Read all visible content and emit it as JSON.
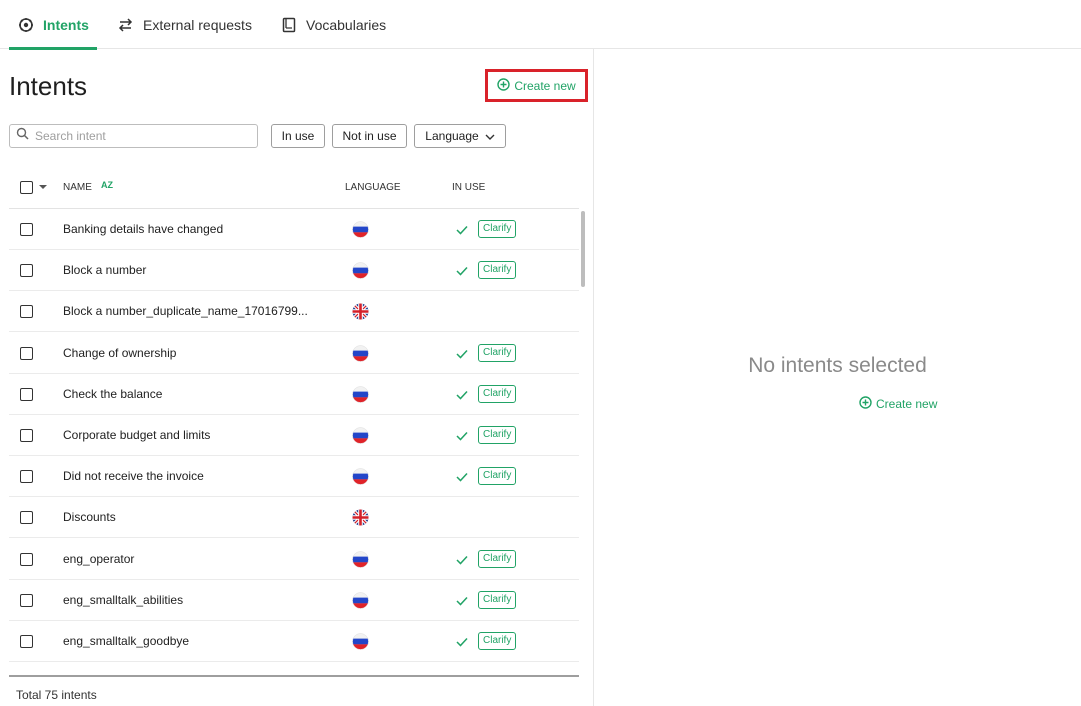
{
  "tabs": [
    {
      "label": "Intents",
      "icon": "brain-gear-icon",
      "active": true
    },
    {
      "label": "External requests",
      "icon": "swap-arrows-icon",
      "active": false
    },
    {
      "label": "Vocabularies",
      "icon": "book-icon",
      "active": false
    }
  ],
  "left_panel": {
    "title": "Intents",
    "create_label": "Create new",
    "search_placeholder": "Search intent",
    "filters": {
      "in_use": "In use",
      "not_in_use": "Not in use",
      "language": "Language"
    },
    "columns": {
      "name": "NAME",
      "sort_indicator": "AZ",
      "language": "LANGUAGE",
      "in_use": "IN USE"
    },
    "rows": [
      {
        "name": "Banking details have changed",
        "lang": "ru",
        "in_use": true,
        "badge": "Clarify"
      },
      {
        "name": "Block a number",
        "lang": "ru",
        "in_use": true,
        "badge": "Clarify"
      },
      {
        "name": "Block a number_duplicate_name_17016799...",
        "lang": "gb",
        "in_use": false,
        "badge": ""
      },
      {
        "name": "Change of ownership",
        "lang": "ru",
        "in_use": true,
        "badge": "Clarify"
      },
      {
        "name": "Check the balance",
        "lang": "ru",
        "in_use": true,
        "badge": "Clarify"
      },
      {
        "name": "Corporate budget and limits",
        "lang": "ru",
        "in_use": true,
        "badge": "Clarify"
      },
      {
        "name": "Did not receive the invoice",
        "lang": "ru",
        "in_use": true,
        "badge": "Clarify"
      },
      {
        "name": "Discounts",
        "lang": "gb",
        "in_use": false,
        "badge": ""
      },
      {
        "name": "eng_operator",
        "lang": "ru",
        "in_use": true,
        "badge": "Clarify"
      },
      {
        "name": "eng_smalltalk_abilities",
        "lang": "ru",
        "in_use": true,
        "badge": "Clarify"
      },
      {
        "name": "eng_smalltalk_goodbye",
        "lang": "ru",
        "in_use": true,
        "badge": "Clarify"
      }
    ],
    "total": "Total 75 intents"
  },
  "right_panel": {
    "empty_message": "No intents selected",
    "create_label": "Create new"
  },
  "colors": {
    "accent": "#21a366",
    "highlight": "#d9222a"
  }
}
